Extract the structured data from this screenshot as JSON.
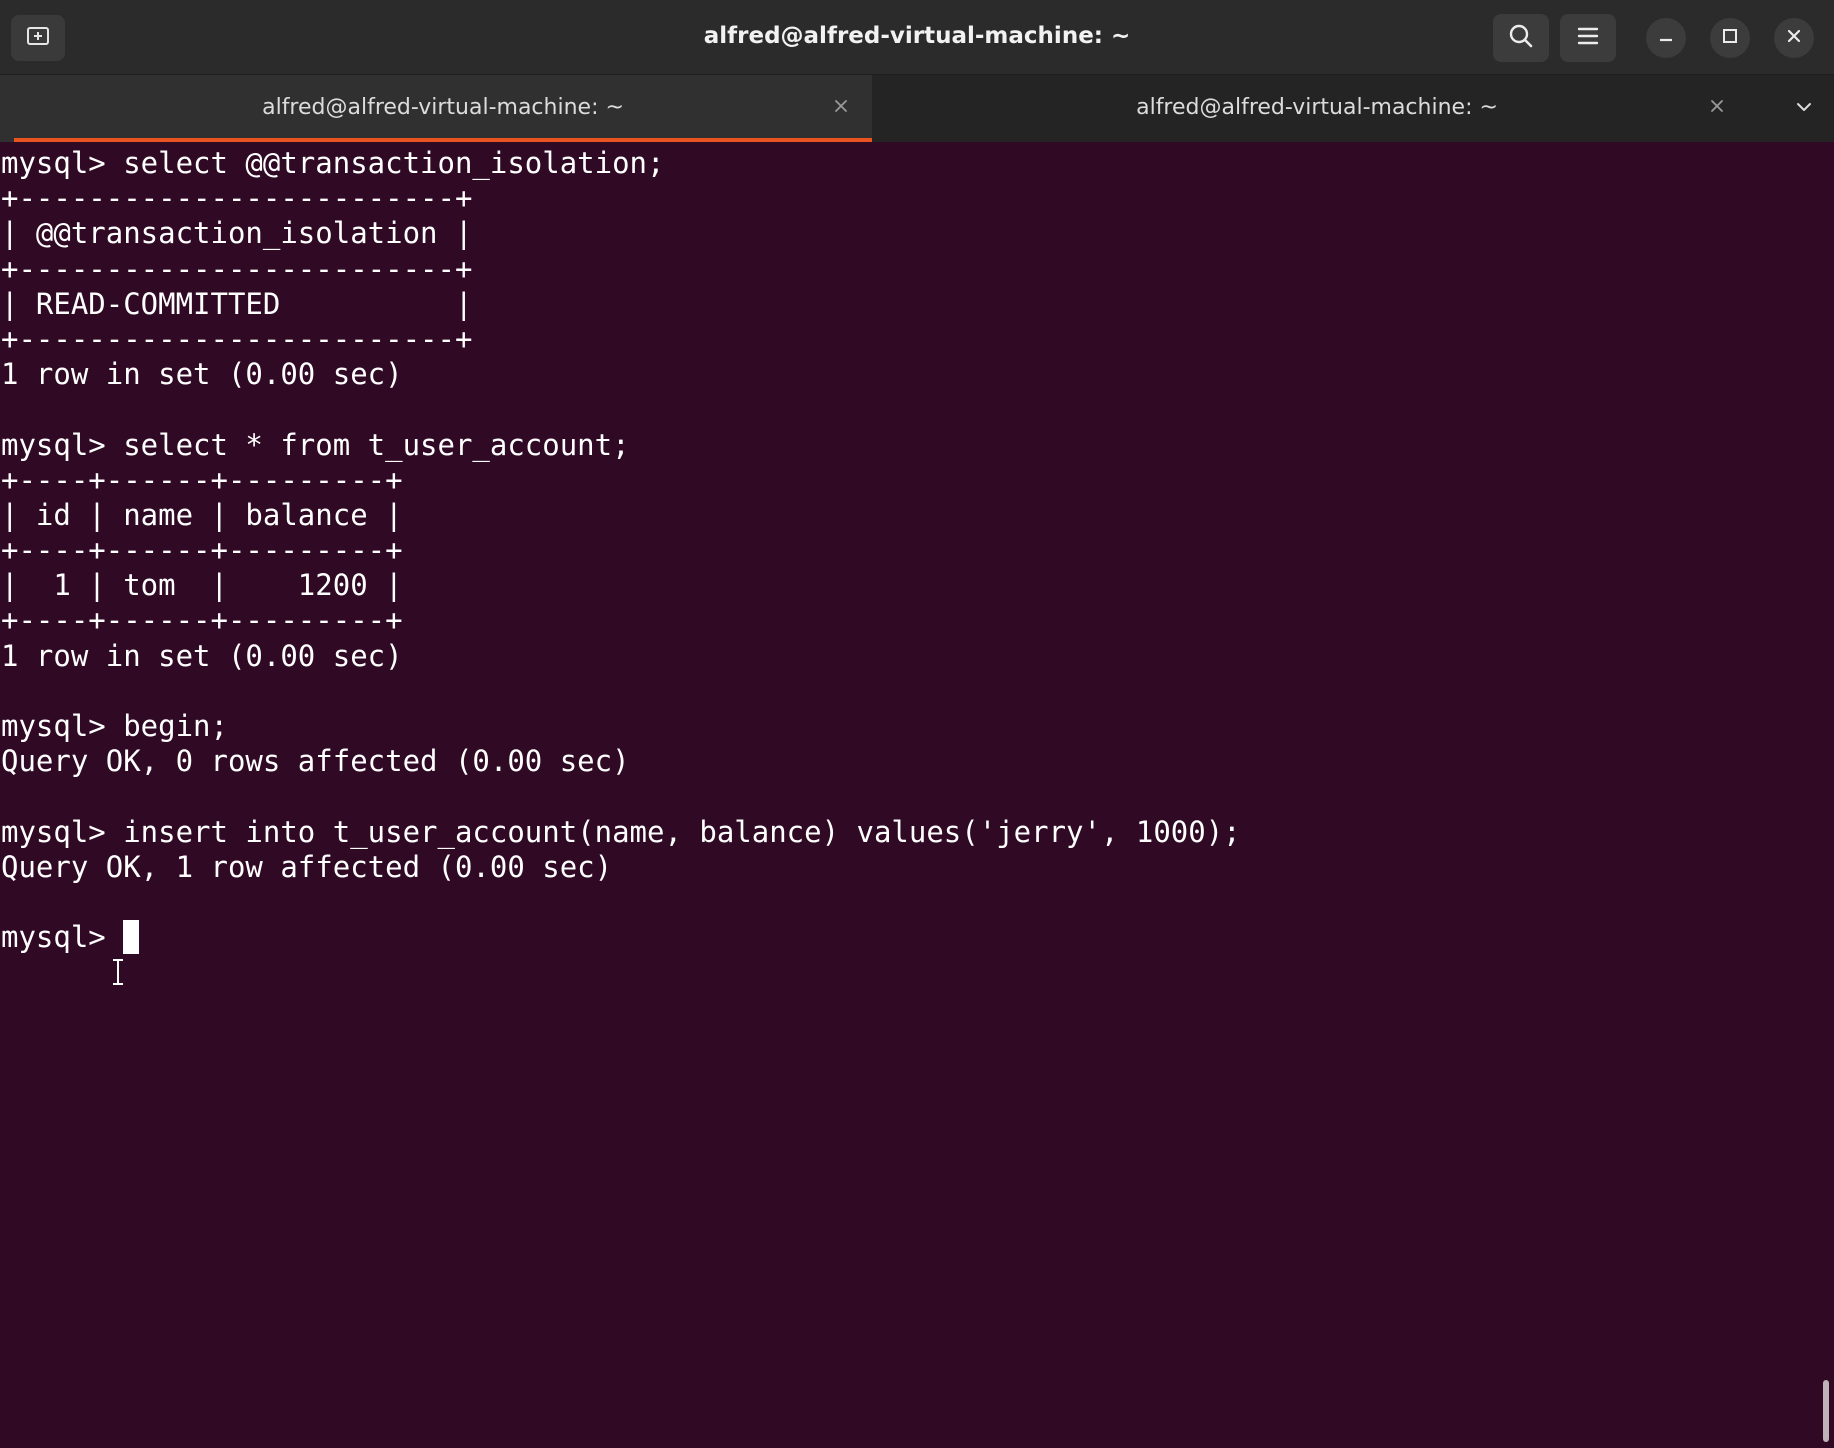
{
  "window": {
    "title": "alfred@alfred-virtual-machine: ~"
  },
  "tabs": [
    {
      "label": "alfred@alfred-virtual-machine: ~",
      "active": true
    },
    {
      "label": "alfred@alfred-virtual-machine: ~",
      "active": false
    }
  ],
  "icons": {
    "new_tab": "new-tab-icon",
    "search": "search-icon",
    "menu": "hamburger-menu-icon",
    "minimize": "minimize-icon",
    "maximize": "maximize-icon",
    "close": "close-icon",
    "tab_close": "close-icon",
    "tab_list": "chevron-down-icon"
  },
  "colors": {
    "terminal_bg": "#300a24",
    "titlebar_bg": "#2b2b2b",
    "tab_accent": "#e95420",
    "text": "#ffffff"
  },
  "terminal": {
    "lines": [
      "mysql> select @@transaction_isolation;",
      "+-------------------------+",
      "| @@transaction_isolation |",
      "+-------------------------+",
      "| READ-COMMITTED          |",
      "+-------------------------+",
      "1 row in set (0.00 sec)",
      "",
      "mysql> select * from t_user_account;",
      "+----+------+---------+",
      "| id | name | balance |",
      "+----+------+---------+",
      "|  1 | tom  |    1200 |",
      "+----+------+---------+",
      "1 row in set (0.00 sec)",
      "",
      "mysql> begin;",
      "Query OK, 0 rows affected (0.00 sec)",
      "",
      "mysql> insert into t_user_account(name, balance) values('jerry', 1000);",
      "Query OK, 1 row affected (0.00 sec)",
      "",
      "mysql> "
    ]
  }
}
